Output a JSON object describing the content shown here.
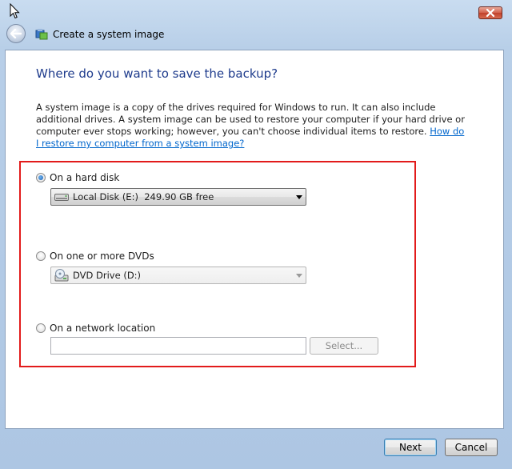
{
  "window": {
    "title": "Create a system image",
    "close_icon": "close-icon",
    "back_icon": "back-arrow-icon",
    "app_icon": "backup-icon",
    "close_color": "#c0412b"
  },
  "page": {
    "heading": "Where do you want to save the backup?",
    "description": "A system image is a copy of the drives required for Windows to run. It can also include additional drives. A system image can be used to restore your computer if your hard drive or computer ever stops working; however, you can't choose individual items to restore. ",
    "help_link": "How do I restore my computer from a system image?"
  },
  "options": {
    "hard_disk": {
      "label": "On a hard disk",
      "selected": true,
      "drive": "Local Disk (E:)  249.90 GB free",
      "drive_icon": "hard-disk-icon"
    },
    "dvd": {
      "label": "On one or more DVDs",
      "selected": false,
      "drive": "DVD Drive (D:)",
      "drive_icon": "dvd-drive-icon"
    },
    "network": {
      "label": "On a network location",
      "selected": false,
      "location_value": "",
      "select_label": "Select..."
    }
  },
  "buttons": {
    "next": "Next",
    "cancel": "Cancel"
  },
  "highlight_color": "#e21b1b"
}
